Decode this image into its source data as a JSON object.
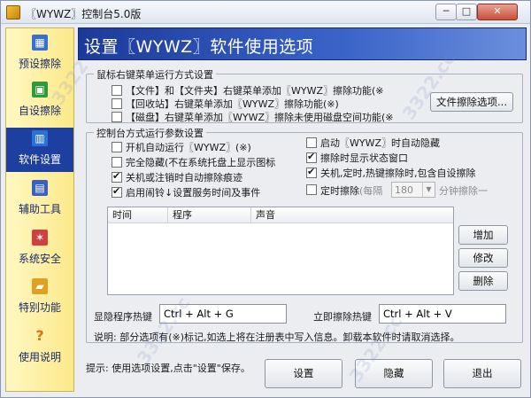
{
  "window": {
    "title": "〖WYWZ〗控制台5.0版",
    "min_label": "─",
    "max_label": "□",
    "close_label": "✕"
  },
  "sidebar": {
    "items": [
      {
        "label": "预设擦除",
        "icon": "preset-erase-icon",
        "color": "#3a6fd0",
        "active": false
      },
      {
        "label": "自设擦除",
        "icon": "custom-erase-icon",
        "color": "#2f9a3a",
        "active": false
      },
      {
        "label": "软件设置",
        "icon": "software-settings-icon",
        "color": "#2a72d8",
        "active": true
      },
      {
        "label": "辅助工具",
        "icon": "tools-icon",
        "color": "#3a60c0",
        "active": false
      },
      {
        "label": "系统安全",
        "icon": "security-icon",
        "color": "#d04040",
        "active": false
      },
      {
        "label": "特别功能",
        "icon": "special-icon",
        "color": "#e0a020",
        "active": false
      },
      {
        "label": "使用说明",
        "icon": "help-icon",
        "color": "#e07010",
        "active": false
      }
    ]
  },
  "header": {
    "title": "设置〖WYWZ〗软件使用选项",
    "bg_color": "#2a4fb8"
  },
  "context_menu_group": {
    "title": "鼠标右键菜单运行方式设置",
    "options": [
      {
        "label": "【文件】和【文件夹】右键菜单添加〖WYWZ〗擦除功能(※",
        "checked": false
      },
      {
        "label": "【回收站】右键菜单添加〖WYWZ〗擦除功能(※)",
        "checked": false
      },
      {
        "label": "【磁盘】右键菜单添加〖WYWZ〗擦除未使用磁盘空间功能(※",
        "checked": false
      }
    ],
    "file_erase_button": "文件擦除选项..."
  },
  "console_group": {
    "title": "控制台方式运行参数设置",
    "left_options": [
      {
        "label": "开机自动运行〖WYWZ〗(※)",
        "checked": false
      },
      {
        "label": "完全隐藏(不在系统托盘上显示图标",
        "checked": false
      },
      {
        "label": "关机或注销时自动擦除痕迹",
        "checked": true
      },
      {
        "label": "启用闹铃↓设置服务时间及事件",
        "checked": true
      }
    ],
    "right_options": [
      {
        "label": "启动〖WYWZ〗时自动隐藏",
        "checked": false
      },
      {
        "label": "擦除时显示状态窗口",
        "checked": true
      },
      {
        "label": "关机,定时,热键擦除时,包含自设擦除",
        "checked": true
      }
    ],
    "timed_erase": {
      "label_pre": "定时擦除",
      "label_mid": "(每隔",
      "interval": "180",
      "label_post": "分钟擦除一"
    },
    "table_columns": [
      "时间",
      "程序",
      "声音"
    ],
    "add_button": "增加",
    "edit_button": "修改",
    "delete_button": "删除"
  },
  "hotkeys": {
    "show_hide_label": "显隐程序热键",
    "show_hide_value": "Ctrl + Alt + G",
    "erase_now_label": "立即擦除热键",
    "erase_now_value": "Ctrl + Alt + V"
  },
  "note": "说明: 部分选项有(※)标记,如选上将在注册表中写入信息。卸载本软件时请取消选择。",
  "footer": {
    "hint": "提示: 使用选项设置,点击\"设置\"保存。",
    "settings_button": "设置",
    "hide_button": "隐藏",
    "exit_button": "退出"
  },
  "watermark": "3322软件站"
}
